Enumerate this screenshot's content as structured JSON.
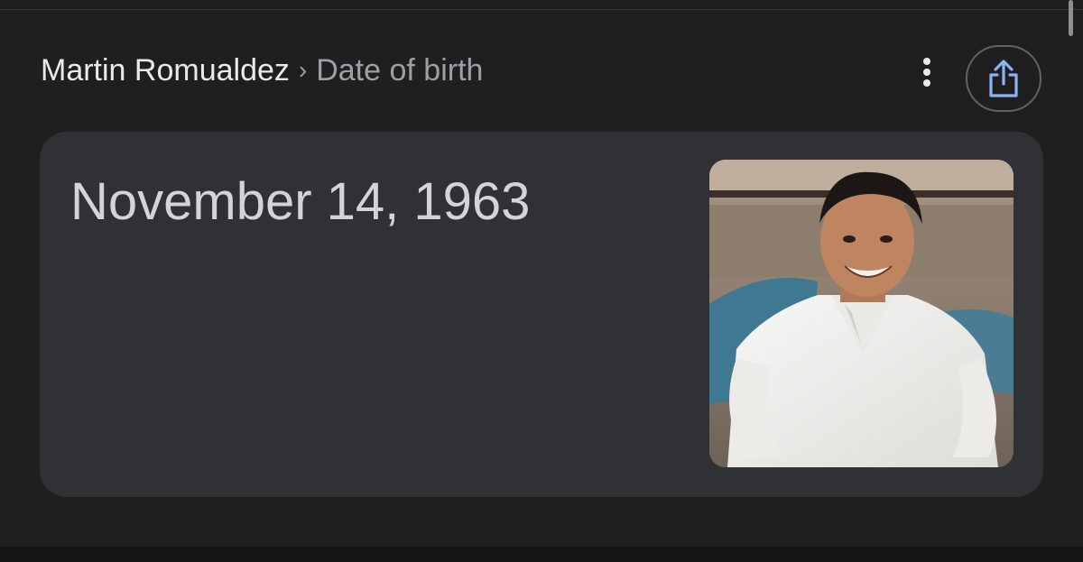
{
  "breadcrumb": {
    "entity": "Martin Romualdez",
    "separator": "›",
    "attribute": "Date of birth"
  },
  "toolbar": {
    "more_icon": "vertical-dots-icon",
    "share_icon": "share-icon"
  },
  "answer_card": {
    "value": "November 14, 1963",
    "photo_alt": "Martin Romualdez"
  },
  "colors": {
    "page_background": "#1f1f20",
    "card_background": "#303134",
    "primary_text": "#e8eaed",
    "secondary_text": "#9aa0a6",
    "share_icon": "#8ab4f8"
  }
}
